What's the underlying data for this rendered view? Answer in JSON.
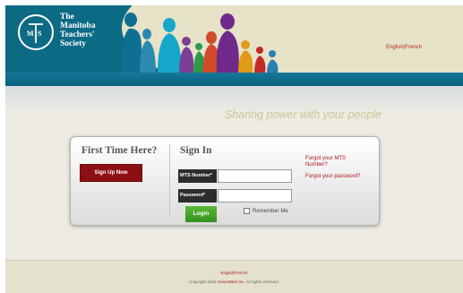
{
  "logo": {
    "monogram": "MTS",
    "lines": [
      "The",
      "Manitoba",
      "Teachers'",
      "Society"
    ]
  },
  "header": {
    "lang_english": "English",
    "lang_separator": "|",
    "lang_french": "French"
  },
  "tagline": "Sharing power with your people",
  "first_time": {
    "title": "First Time Here?",
    "signup_label": "Sign Up Now"
  },
  "sign_in": {
    "title": "Sign In",
    "mts_number_label": "MTS Number*",
    "mts_number_value": "",
    "password_label": "Password*",
    "password_value": "",
    "login_label": "Login",
    "remember_label": "Remember Me",
    "remember_checked": false,
    "forgot_mts_line1": "Forgot your MTS",
    "forgot_mts_line2": "Number?",
    "forgot_password": "Forgot your password?"
  },
  "footer": {
    "lang_english": "English",
    "lang_separator": "|",
    "lang_french": "French",
    "copyright_prefix": "Copyright 2015",
    "company": "UnionWare Inc.",
    "copyright_suffix": "All rights reserved."
  },
  "colors": {
    "header_blue": "#0d6a85",
    "signup_red": "#8c0f14",
    "login_green": "#47a42a",
    "link_red": "#a8161c",
    "tagline": "#c9c69a"
  }
}
